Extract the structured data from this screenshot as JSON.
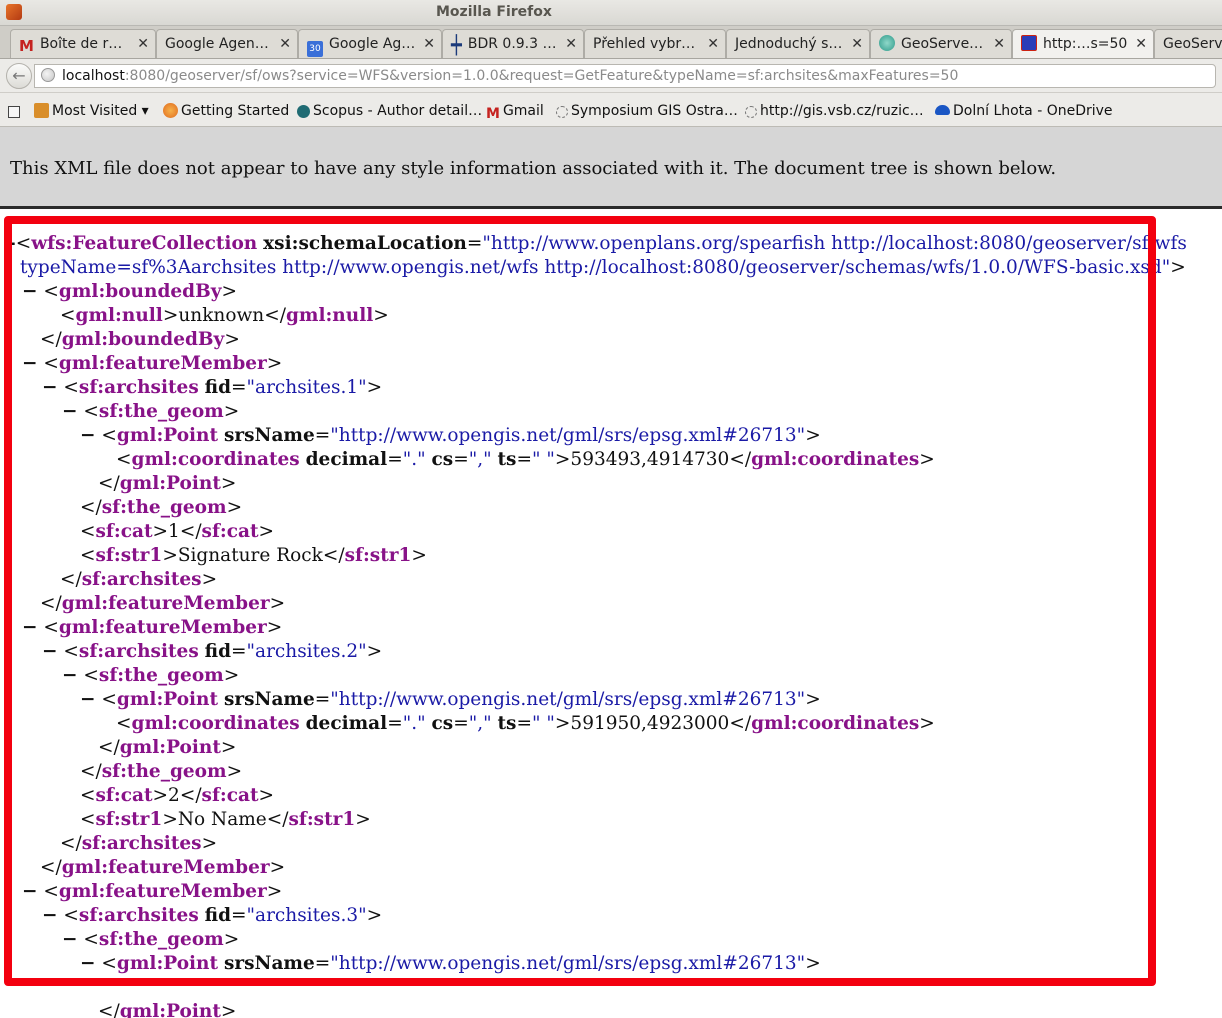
{
  "window": {
    "title": "Mozilla Firefox"
  },
  "tabs": [
    {
      "label": "Boîte de r…",
      "icon": "gmail-icon",
      "color": "#c5221f"
    },
    {
      "label": "Google Agen…",
      "icon": "",
      "color": ""
    },
    {
      "label": "Google Ag…",
      "icon": "calendar-icon",
      "color": "#3a6fd8"
    },
    {
      "label": "BDR 0.9.3 …",
      "icon": "cross-icon",
      "color": "#1b3a7a"
    },
    {
      "label": "Přehled vybr…",
      "icon": "",
      "color": ""
    },
    {
      "label": "Jednoduchý s…",
      "icon": "",
      "color": ""
    },
    {
      "label": "GeoServe…",
      "icon": "geoserver-icon",
      "color": "#2e9a8a"
    },
    {
      "label": "http:…s=50",
      "icon": "xml-page-icon",
      "color": "#2a3cb8",
      "active": true
    },
    {
      "label": "GeoServ",
      "icon": "",
      "color": ""
    }
  ],
  "tab_close_glyph": "✕",
  "nav": {
    "back_glyph": "←",
    "url_host": "localhost",
    "url_rest": ":8080/geoserver/sf/ows?service=WFS&version=1.0.0&request=GetFeature&typeName=sf:archsites&maxFeatures=50"
  },
  "bookmarks": [
    {
      "label": "Most Visited ▾",
      "icon": "folder-icon",
      "color": "#d98e2a"
    },
    {
      "label": "Getting Started",
      "icon": "firefox-icon",
      "color": "#e06a1f"
    },
    {
      "label": "Scopus - Author detail…",
      "icon": "scopus-icon",
      "color": "#1f6b73"
    },
    {
      "label": "Gmail",
      "icon": "gmail-icon",
      "color": "#c5221f"
    },
    {
      "label": "Symposium GIS Ostra…",
      "icon": "dashed-globe-icon",
      "color": "#777777"
    },
    {
      "label": "http://gis.vsb.cz/ruzic…",
      "icon": "dashed-globe-icon",
      "color": "#777777"
    },
    {
      "label": "Dolní Lhota - OneDrive",
      "icon": "cloud-icon",
      "color": "#1a56c4"
    }
  ],
  "info_message": "This XML file does not appear to have any style information associated with it. The document tree is shown below.",
  "xml": {
    "collection_tag": "wfs:FeatureCollection",
    "schema_attr": "xsi:schemaLocation",
    "schema_value_1": "\"http://www.openplans.org/spearfish http://localhost:8080/geoserver/sf/wfs",
    "schema_value_2": "typeName=sf%3Aarchsites http://www.opengis.net/wfs http://localhost:8080/geoserver/schemas/wfs/1.0.0/WFS-basic.xsd\"",
    "bounded_tag": "gml:boundedBy",
    "null_tag": "gml:null",
    "null_value": "unknown",
    "member_tag": "gml:featureMember",
    "site_tag": "sf:archsites",
    "fid_attr": "fid",
    "geom_tag": "sf:the_geom",
    "point_tag": "gml:Point",
    "srs_attr": "srsName",
    "srs_value": "\"http://www.opengis.net/gml/srs/epsg.xml#26713\"",
    "coords_tag": "gml:coordinates",
    "decimal_attr": "decimal",
    "decimal_value": "\".\"",
    "cs_attr": "cs",
    "cs_value": "\",\"",
    "ts_attr": "ts",
    "ts_value": "\" \"",
    "cat_tag": "sf:cat",
    "str1_tag": "sf:str1",
    "features": [
      {
        "fid": "\"archsites.1\"",
        "coords": "593493,4914730",
        "cat": "1",
        "str1": "Signature Rock"
      },
      {
        "fid": "\"archsites.2\"",
        "coords": "591950,4923000",
        "cat": "2",
        "str1": "No Name"
      },
      {
        "fid": "\"archsites.3\""
      }
    ]
  }
}
